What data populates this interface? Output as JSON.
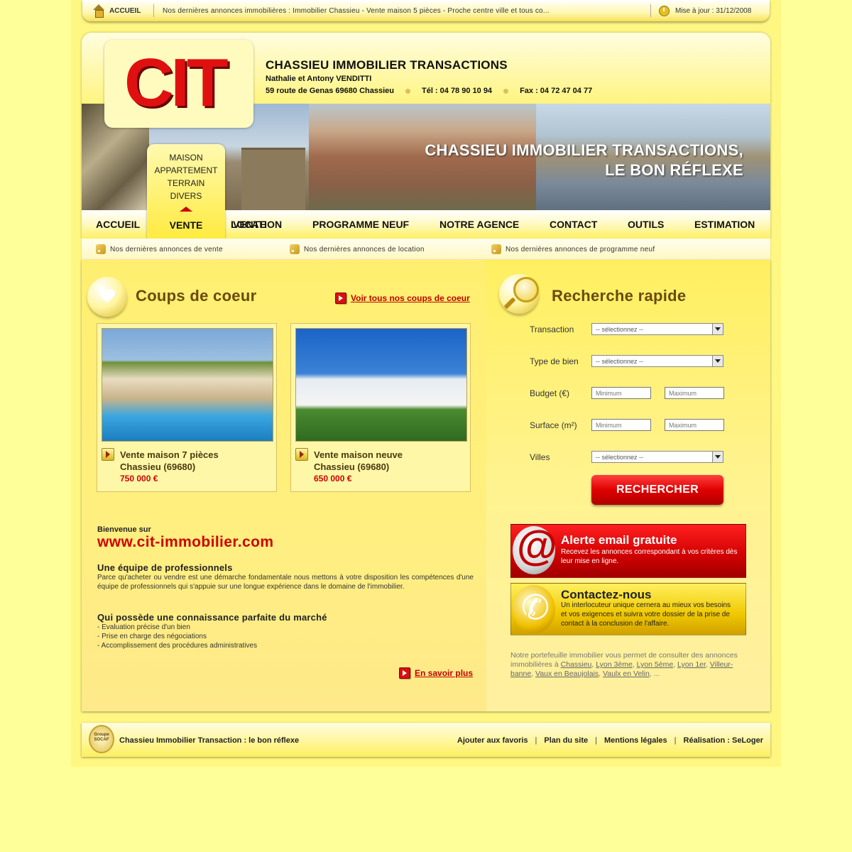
{
  "topbar": {
    "home": "ACCUEIL",
    "ticker": "Nos dernières annonces immobilières : Immobilier Chassieu - Vente maison 5 pièces - Proche centre ville et tous co...",
    "update": "Mise à jour : 31/12/2008"
  },
  "header": {
    "logo": "CIT",
    "company": "CHASSIEU IMMOBILIER TRANSACTIONS",
    "owners": "Nathalie et Antony VENDITTI",
    "address": "59 route de Genas 69680 Chassieu",
    "tel": "Tél : 04 78 90 10 94",
    "fax": "Fax : 04 72 47 04 77",
    "slogan1": "CHASSIEU IMMOBILIER TRANSACTIONS,",
    "slogan2": "LE BON RÉFLEXE"
  },
  "submenu": [
    "MAISON",
    "APPARTEMENT",
    "TERRAIN",
    "DIVERS"
  ],
  "nav": [
    "ACCUEIL",
    "VENTE",
    "LOCATION",
    "PROGRAMME NEUF",
    "NOTRE AGENCE",
    "CONTACT",
    "OUTILS",
    "ESTIMATION"
  ],
  "rss": [
    "Nos dernières annonces de vente",
    "Nos dernières annonces de location",
    "Nos dernières annonces de programme neuf"
  ],
  "coups": {
    "title": "Coups de coeur",
    "link": "Voir tous nos coups de coeur",
    "cards": [
      {
        "line1": "Vente maison 7 pièces",
        "line2": "Chassieu (69680)",
        "price": "750 000 €"
      },
      {
        "line1": "Vente maison neuve",
        "line2": "Chassieu (69680)",
        "price": "650 000 €"
      }
    ]
  },
  "welcome": {
    "small": "Bienvenue sur",
    "url": "www.cit-immobilier.com",
    "h1": "Une équipe de professionnels",
    "p1": "Parce qu'acheter ou vendre est une démarche fondamentale nous mettons à votre disposition les compétences d'une équipe de professionnels qui s'appuie sur une longue expérience dans le domaine de l'immobilier.",
    "h2": "Qui possède une connaissance parfaite du marché",
    "list": [
      "- Evaluation précise d'un bien",
      "- Prise en charge des négociations",
      "- Accomplissement des procédures administratives"
    ],
    "more": "En savoir plus"
  },
  "search": {
    "title": "Recherche rapide",
    "transaction": "Transaction",
    "type": "Type de bien",
    "budget": "Budget (€)",
    "surface": "Surface (m²)",
    "villes": "Villes",
    "select_placeholder": "-- sélectionnez --",
    "min": "Minimum",
    "max": "Maximum",
    "button": "RECHERCHER"
  },
  "alert": {
    "title": "Alerte email gratuite",
    "text": "Recevez les annonces correspondant à vos critères dès leur mise en ligne."
  },
  "contact": {
    "title": "Contactez-nous",
    "text": "Un interlocuteur unique cernera au mieux vos besoins et vos exigences et suivra votre dossier de la prise de contact à la conclusion de l'affaire."
  },
  "portfolio": {
    "text": "Notre portefeuille immobilier vous permet de consulter des annonces immobilières à",
    "cities": [
      "Chassieu",
      "Lyon 3ème",
      "Lyon 5ème",
      "Lyon 1er",
      "Villeur-banne",
      "Vaux en Beaujolais",
      "Vaulx en Velin"
    ],
    "ellipsis": "..."
  },
  "footer": {
    "badge": "Groupe SOCAF",
    "tagline": "Chassieu Immobilier Transaction : le bon réflexe",
    "links": [
      "Ajouter aux favoris",
      "Plan du site",
      "Mentions légales",
      "Réalisation : SeLoger"
    ]
  }
}
